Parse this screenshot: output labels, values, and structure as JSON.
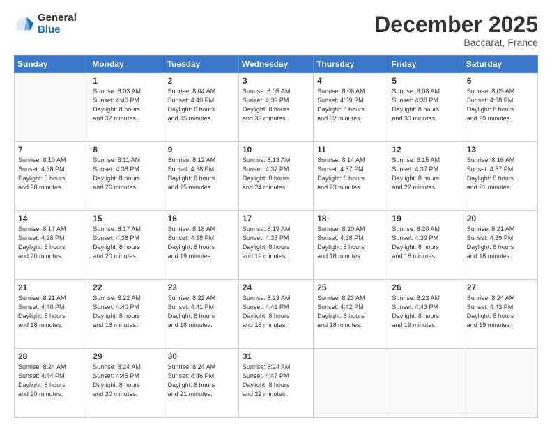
{
  "logo": {
    "general": "General",
    "blue": "Blue"
  },
  "title": "December 2025",
  "location": "Baccarat, France",
  "days_of_week": [
    "Sunday",
    "Monday",
    "Tuesday",
    "Wednesday",
    "Thursday",
    "Friday",
    "Saturday"
  ],
  "weeks": [
    [
      {
        "day": "",
        "sunrise": "",
        "sunset": "",
        "daylight": "",
        "empty": true
      },
      {
        "day": "1",
        "sunrise": "Sunrise: 8:03 AM",
        "sunset": "Sunset: 4:40 PM",
        "daylight": "Daylight: 8 hours and 37 minutes."
      },
      {
        "day": "2",
        "sunrise": "Sunrise: 8:04 AM",
        "sunset": "Sunset: 4:40 PM",
        "daylight": "Daylight: 8 hours and 35 minutes."
      },
      {
        "day": "3",
        "sunrise": "Sunrise: 8:05 AM",
        "sunset": "Sunset: 4:39 PM",
        "daylight": "Daylight: 8 hours and 33 minutes."
      },
      {
        "day": "4",
        "sunrise": "Sunrise: 8:06 AM",
        "sunset": "Sunset: 4:39 PM",
        "daylight": "Daylight: 8 hours and 32 minutes."
      },
      {
        "day": "5",
        "sunrise": "Sunrise: 8:08 AM",
        "sunset": "Sunset: 4:38 PM",
        "daylight": "Daylight: 8 hours and 30 minutes."
      },
      {
        "day": "6",
        "sunrise": "Sunrise: 8:09 AM",
        "sunset": "Sunset: 4:38 PM",
        "daylight": "Daylight: 8 hours and 29 minutes."
      }
    ],
    [
      {
        "day": "7",
        "sunrise": "Sunrise: 8:10 AM",
        "sunset": "Sunset: 4:38 PM",
        "daylight": "Daylight: 8 hours and 28 minutes."
      },
      {
        "day": "8",
        "sunrise": "Sunrise: 8:11 AM",
        "sunset": "Sunset: 4:38 PM",
        "daylight": "Daylight: 8 hours and 26 minutes."
      },
      {
        "day": "9",
        "sunrise": "Sunrise: 8:12 AM",
        "sunset": "Sunset: 4:38 PM",
        "daylight": "Daylight: 8 hours and 25 minutes."
      },
      {
        "day": "10",
        "sunrise": "Sunrise: 8:13 AM",
        "sunset": "Sunset: 4:37 PM",
        "daylight": "Daylight: 8 hours and 24 minutes."
      },
      {
        "day": "11",
        "sunrise": "Sunrise: 8:14 AM",
        "sunset": "Sunset: 4:37 PM",
        "daylight": "Daylight: 8 hours and 23 minutes."
      },
      {
        "day": "12",
        "sunrise": "Sunrise: 8:15 AM",
        "sunset": "Sunset: 4:37 PM",
        "daylight": "Daylight: 8 hours and 22 minutes."
      },
      {
        "day": "13",
        "sunrise": "Sunrise: 8:16 AM",
        "sunset": "Sunset: 4:37 PM",
        "daylight": "Daylight: 8 hours and 21 minutes."
      }
    ],
    [
      {
        "day": "14",
        "sunrise": "Sunrise: 8:17 AM",
        "sunset": "Sunset: 4:38 PM",
        "daylight": "Daylight: 8 hours and 20 minutes."
      },
      {
        "day": "15",
        "sunrise": "Sunrise: 8:17 AM",
        "sunset": "Sunset: 4:38 PM",
        "daylight": "Daylight: 8 hours and 20 minutes."
      },
      {
        "day": "16",
        "sunrise": "Sunrise: 8:18 AM",
        "sunset": "Sunset: 4:38 PM",
        "daylight": "Daylight: 8 hours and 19 minutes."
      },
      {
        "day": "17",
        "sunrise": "Sunrise: 8:19 AM",
        "sunset": "Sunset: 4:38 PM",
        "daylight": "Daylight: 8 hours and 19 minutes."
      },
      {
        "day": "18",
        "sunrise": "Sunrise: 8:20 AM",
        "sunset": "Sunset: 4:38 PM",
        "daylight": "Daylight: 8 hours and 18 minutes."
      },
      {
        "day": "19",
        "sunrise": "Sunrise: 8:20 AM",
        "sunset": "Sunset: 4:39 PM",
        "daylight": "Daylight: 8 hours and 18 minutes."
      },
      {
        "day": "20",
        "sunrise": "Sunrise: 8:21 AM",
        "sunset": "Sunset: 4:39 PM",
        "daylight": "Daylight: 8 hours and 18 minutes."
      }
    ],
    [
      {
        "day": "21",
        "sunrise": "Sunrise: 8:21 AM",
        "sunset": "Sunset: 4:40 PM",
        "daylight": "Daylight: 8 hours and 18 minutes."
      },
      {
        "day": "22",
        "sunrise": "Sunrise: 8:22 AM",
        "sunset": "Sunset: 4:40 PM",
        "daylight": "Daylight: 8 hours and 18 minutes."
      },
      {
        "day": "23",
        "sunrise": "Sunrise: 8:22 AM",
        "sunset": "Sunset: 4:41 PM",
        "daylight": "Daylight: 8 hours and 18 minutes."
      },
      {
        "day": "24",
        "sunrise": "Sunrise: 8:23 AM",
        "sunset": "Sunset: 4:41 PM",
        "daylight": "Daylight: 8 hours and 18 minutes."
      },
      {
        "day": "25",
        "sunrise": "Sunrise: 8:23 AM",
        "sunset": "Sunset: 4:42 PM",
        "daylight": "Daylight: 8 hours and 18 minutes."
      },
      {
        "day": "26",
        "sunrise": "Sunrise: 8:23 AM",
        "sunset": "Sunset: 4:43 PM",
        "daylight": "Daylight: 8 hours and 19 minutes."
      },
      {
        "day": "27",
        "sunrise": "Sunrise: 8:24 AM",
        "sunset": "Sunset: 4:43 PM",
        "daylight": "Daylight: 8 hours and 19 minutes."
      }
    ],
    [
      {
        "day": "28",
        "sunrise": "Sunrise: 8:24 AM",
        "sunset": "Sunset: 4:44 PM",
        "daylight": "Daylight: 8 hours and 20 minutes."
      },
      {
        "day": "29",
        "sunrise": "Sunrise: 8:24 AM",
        "sunset": "Sunset: 4:45 PM",
        "daylight": "Daylight: 8 hours and 20 minutes."
      },
      {
        "day": "30",
        "sunrise": "Sunrise: 8:24 AM",
        "sunset": "Sunset: 4:46 PM",
        "daylight": "Daylight: 8 hours and 21 minutes."
      },
      {
        "day": "31",
        "sunrise": "Sunrise: 8:24 AM",
        "sunset": "Sunset: 4:47 PM",
        "daylight": "Daylight: 8 hours and 22 minutes."
      },
      {
        "day": "",
        "sunrise": "",
        "sunset": "",
        "daylight": "",
        "empty": true
      },
      {
        "day": "",
        "sunrise": "",
        "sunset": "",
        "daylight": "",
        "empty": true
      },
      {
        "day": "",
        "sunrise": "",
        "sunset": "",
        "daylight": "",
        "empty": true
      }
    ]
  ]
}
